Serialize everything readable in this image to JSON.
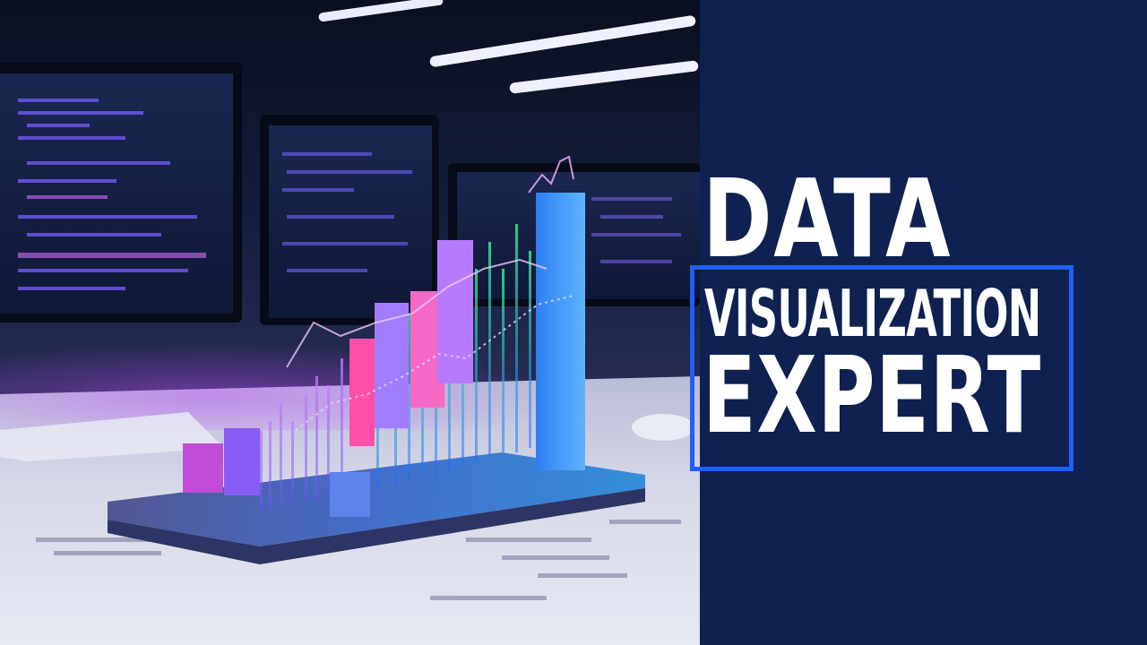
{
  "hero": {
    "title_line_1": "DATA",
    "title_line_2": "VISUALIZATION",
    "title_line_3": "EXPERT"
  },
  "colors": {
    "panel_background": "#0e2150",
    "frame_accent": "#1f5eff",
    "title_text": "#ffffff"
  },
  "scene": {
    "icon": "3d-bar-chart-illustration"
  }
}
